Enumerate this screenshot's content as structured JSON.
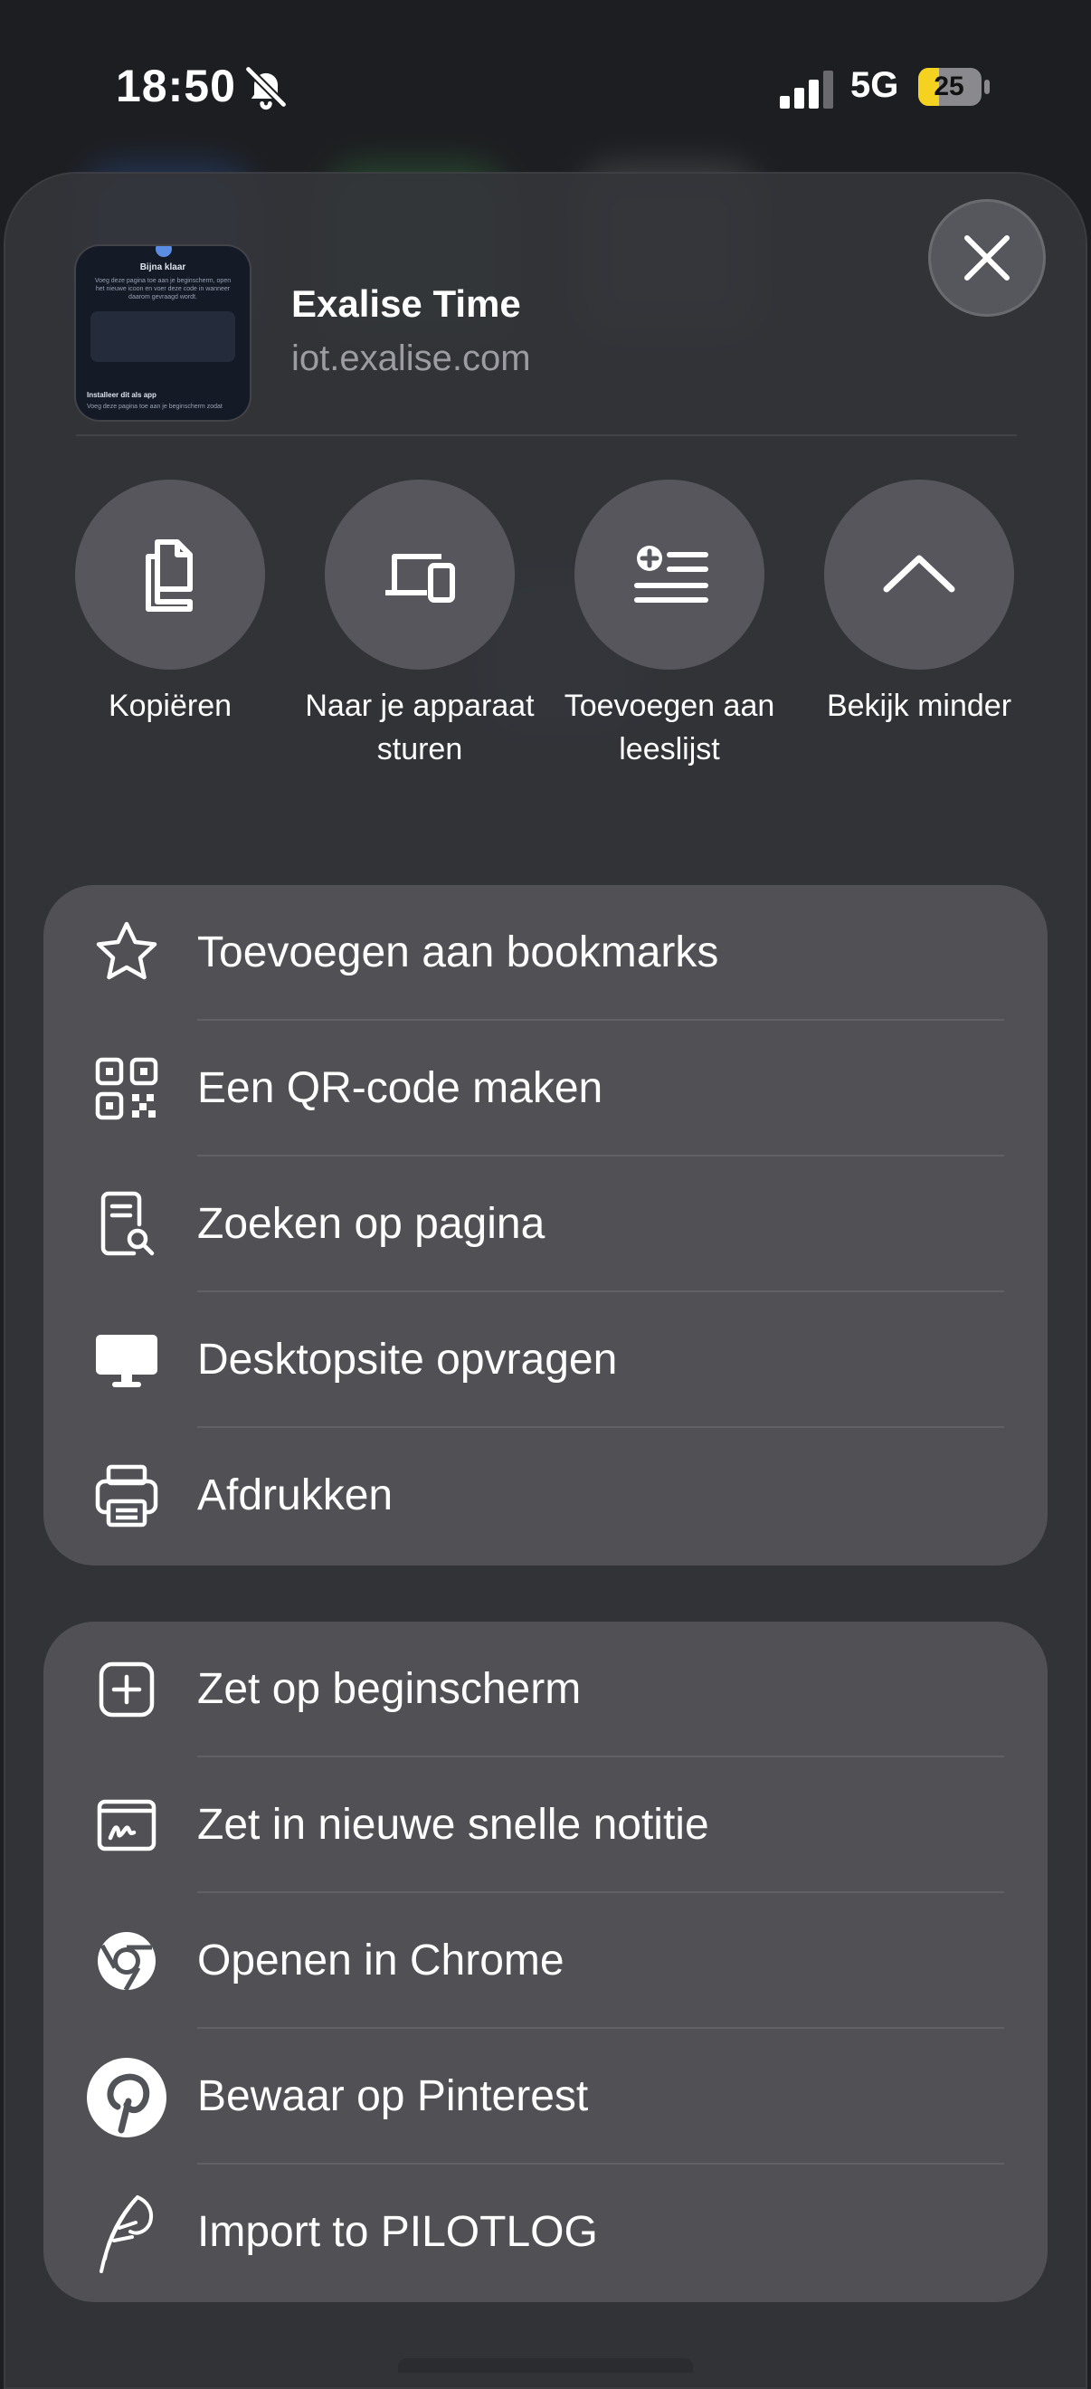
{
  "status_bar": {
    "time": "18:50",
    "network": "5G",
    "battery": "25",
    "icons": [
      "bell-slash-icon",
      "signal-icon",
      "battery-icon"
    ]
  },
  "header": {
    "thumbnail": {
      "title": "Bijna klaar",
      "text": "Voeg deze pagina toe aan je beginscherm, open het nieuwe icoon en voer deze code in wanneer daarom gevraagd wordt.",
      "section_title": "Installeer dit als app",
      "section_text": "Voeg deze pagina toe aan je beginscherm zodat"
    },
    "title": "Exalise Time",
    "url": "iot.exalise.com",
    "close_icon": "close-icon"
  },
  "actions": [
    {
      "label": "Kopiëren",
      "icon": "copy-icon"
    },
    {
      "label": "Naar je apparaat sturen",
      "icon": "devices-icon"
    },
    {
      "label": "Toevoegen aan leeslijst",
      "icon": "reading-list-add-icon"
    },
    {
      "label": "Bekijk minder",
      "icon": "chevron-up-icon"
    }
  ],
  "group1": [
    {
      "label": "Toevoegen aan bookmarks",
      "icon": "star-icon"
    },
    {
      "label": "Een QR-code maken",
      "icon": "qr-code-icon"
    },
    {
      "label": "Zoeken op pagina",
      "icon": "find-in-page-icon"
    },
    {
      "label": "Desktopsite opvragen",
      "icon": "desktop-icon"
    },
    {
      "label": "Afdrukken",
      "icon": "printer-icon"
    }
  ],
  "group2": [
    {
      "label": "Zet op beginscherm",
      "icon": "add-to-home-icon"
    },
    {
      "label": "Zet in nieuwe snelle notitie",
      "icon": "quick-note-icon"
    },
    {
      "label": "Openen in Chrome",
      "icon": "chrome-icon"
    },
    {
      "label": "Bewaar op Pinterest",
      "icon": "pinterest-icon"
    },
    {
      "label": "Import to PILOTLOG",
      "icon": "pilotlog-icon"
    }
  ]
}
